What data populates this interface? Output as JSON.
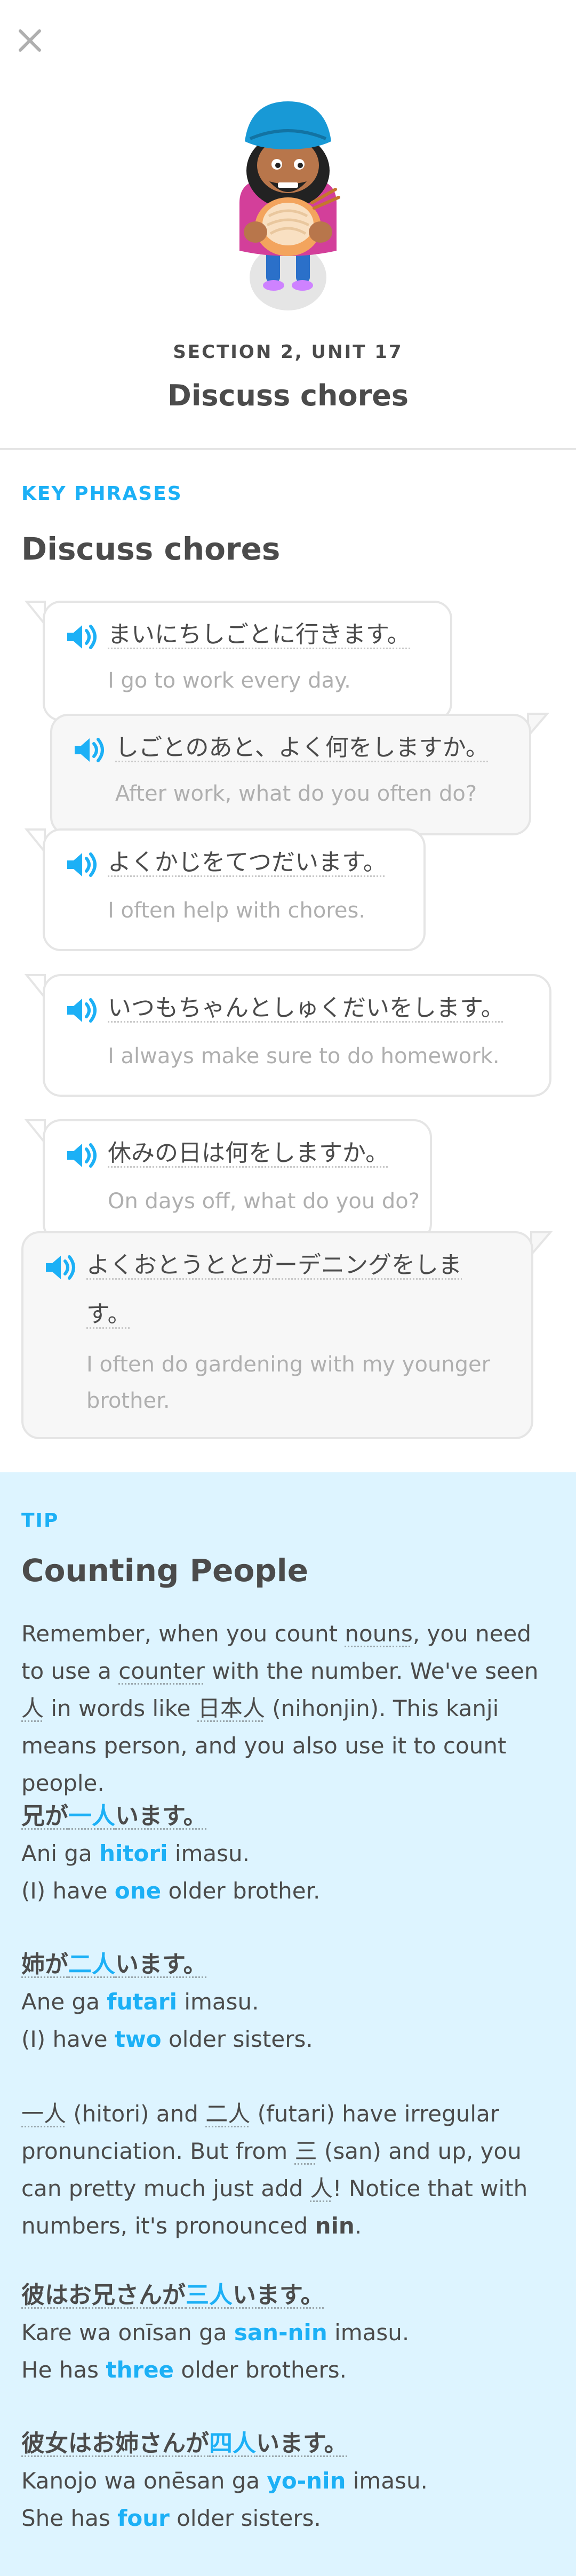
{
  "header": {
    "close_icon": "close-icon",
    "section_label": "SECTION 2, UNIT 17",
    "unit_title": "Discuss chores"
  },
  "key_phrases": {
    "label": "KEY PHRASES",
    "title": "Discuss chores",
    "phrases": [
      {
        "jp": "まいにちしごとに行きます。",
        "en": "I go to work every day."
      },
      {
        "jp": "しごとのあと、よく何をしますか。",
        "en": "After work, what do you often do?"
      },
      {
        "jp": "よくかじをてつだいます。",
        "en": "I often help with chores."
      },
      {
        "jp": "いつもちゃんとしゅくだいをします。",
        "en": "I always make sure to do homework."
      },
      {
        "jp": "休みの日は何をしますか。",
        "en": "On days off, what do you do?"
      },
      {
        "jp_line1": "よくおとうととガーデニングをしま",
        "jp_line2": "す。",
        "en_line1": "I often do gardening with my younger",
        "en_line2": "brother."
      }
    ]
  },
  "tip": {
    "label": "TIP",
    "title": "Counting People",
    "intro": {
      "t1": "Remember, when you count ",
      "nouns": "nouns",
      "t2": ", you need to use a ",
      "counter": "counter",
      "t3": " with the number. We've seen ",
      "kanji_person": "人",
      "t4": " in words like ",
      "nihonjin": "日本人",
      "t5": " (nihonjin). This kanji means person, and you also use it to count people."
    },
    "example1": {
      "jp_a": "兄が",
      "jp_hl": "一人",
      "jp_b": "います。",
      "rom_a": "Ani ga ",
      "rom_hl": "hitori",
      "rom_b": " imasu.",
      "en_a": "(I) have ",
      "en_hl": "one",
      "en_b": " older brother."
    },
    "example2": {
      "jp_a": "姉が",
      "jp_hl": "二人",
      "jp_b": "います。",
      "rom_a": "Ane ga ",
      "rom_hl": "futari",
      "rom_b": " imasu.",
      "en_a": "(I) have ",
      "en_hl": "two",
      "en_b": " older sisters."
    },
    "irregular": {
      "k1": "一人",
      "t1": " (hitori) and ",
      "k2": "二人",
      "t2": " (futari) have irregular pronunciation. But from ",
      "k3": "三",
      "t3": " (san) and up, you can pretty much just add ",
      "k4": "人",
      "t4": "! Notice that with numbers, it's pronounced ",
      "nin": "nin",
      "t5": "."
    },
    "example3": {
      "jp_a": "彼はお兄さんが",
      "jp_hl": "三人",
      "jp_b": "います。",
      "rom_a": "Kare wa onīsan ga ",
      "rom_hl": "san-nin",
      "rom_b": " imasu.",
      "en_a": "He has ",
      "en_hl": "three",
      "en_b": " older brothers."
    },
    "example4": {
      "jp_a": "彼女はお姉さんが",
      "jp_hl": "四人",
      "jp_b": "います。",
      "rom_a": "Kanojo wa onēsan ga ",
      "rom_hl": "yo-nin",
      "rom_b": " imasu.",
      "en_a": "She has ",
      "en_hl": "four",
      "en_b": " older sisters."
    }
  },
  "colors": {
    "accent": "#1cb0f6",
    "tip_bg": "#ddf4ff",
    "text": "#4b4b4b",
    "muted": "#afafaf"
  }
}
